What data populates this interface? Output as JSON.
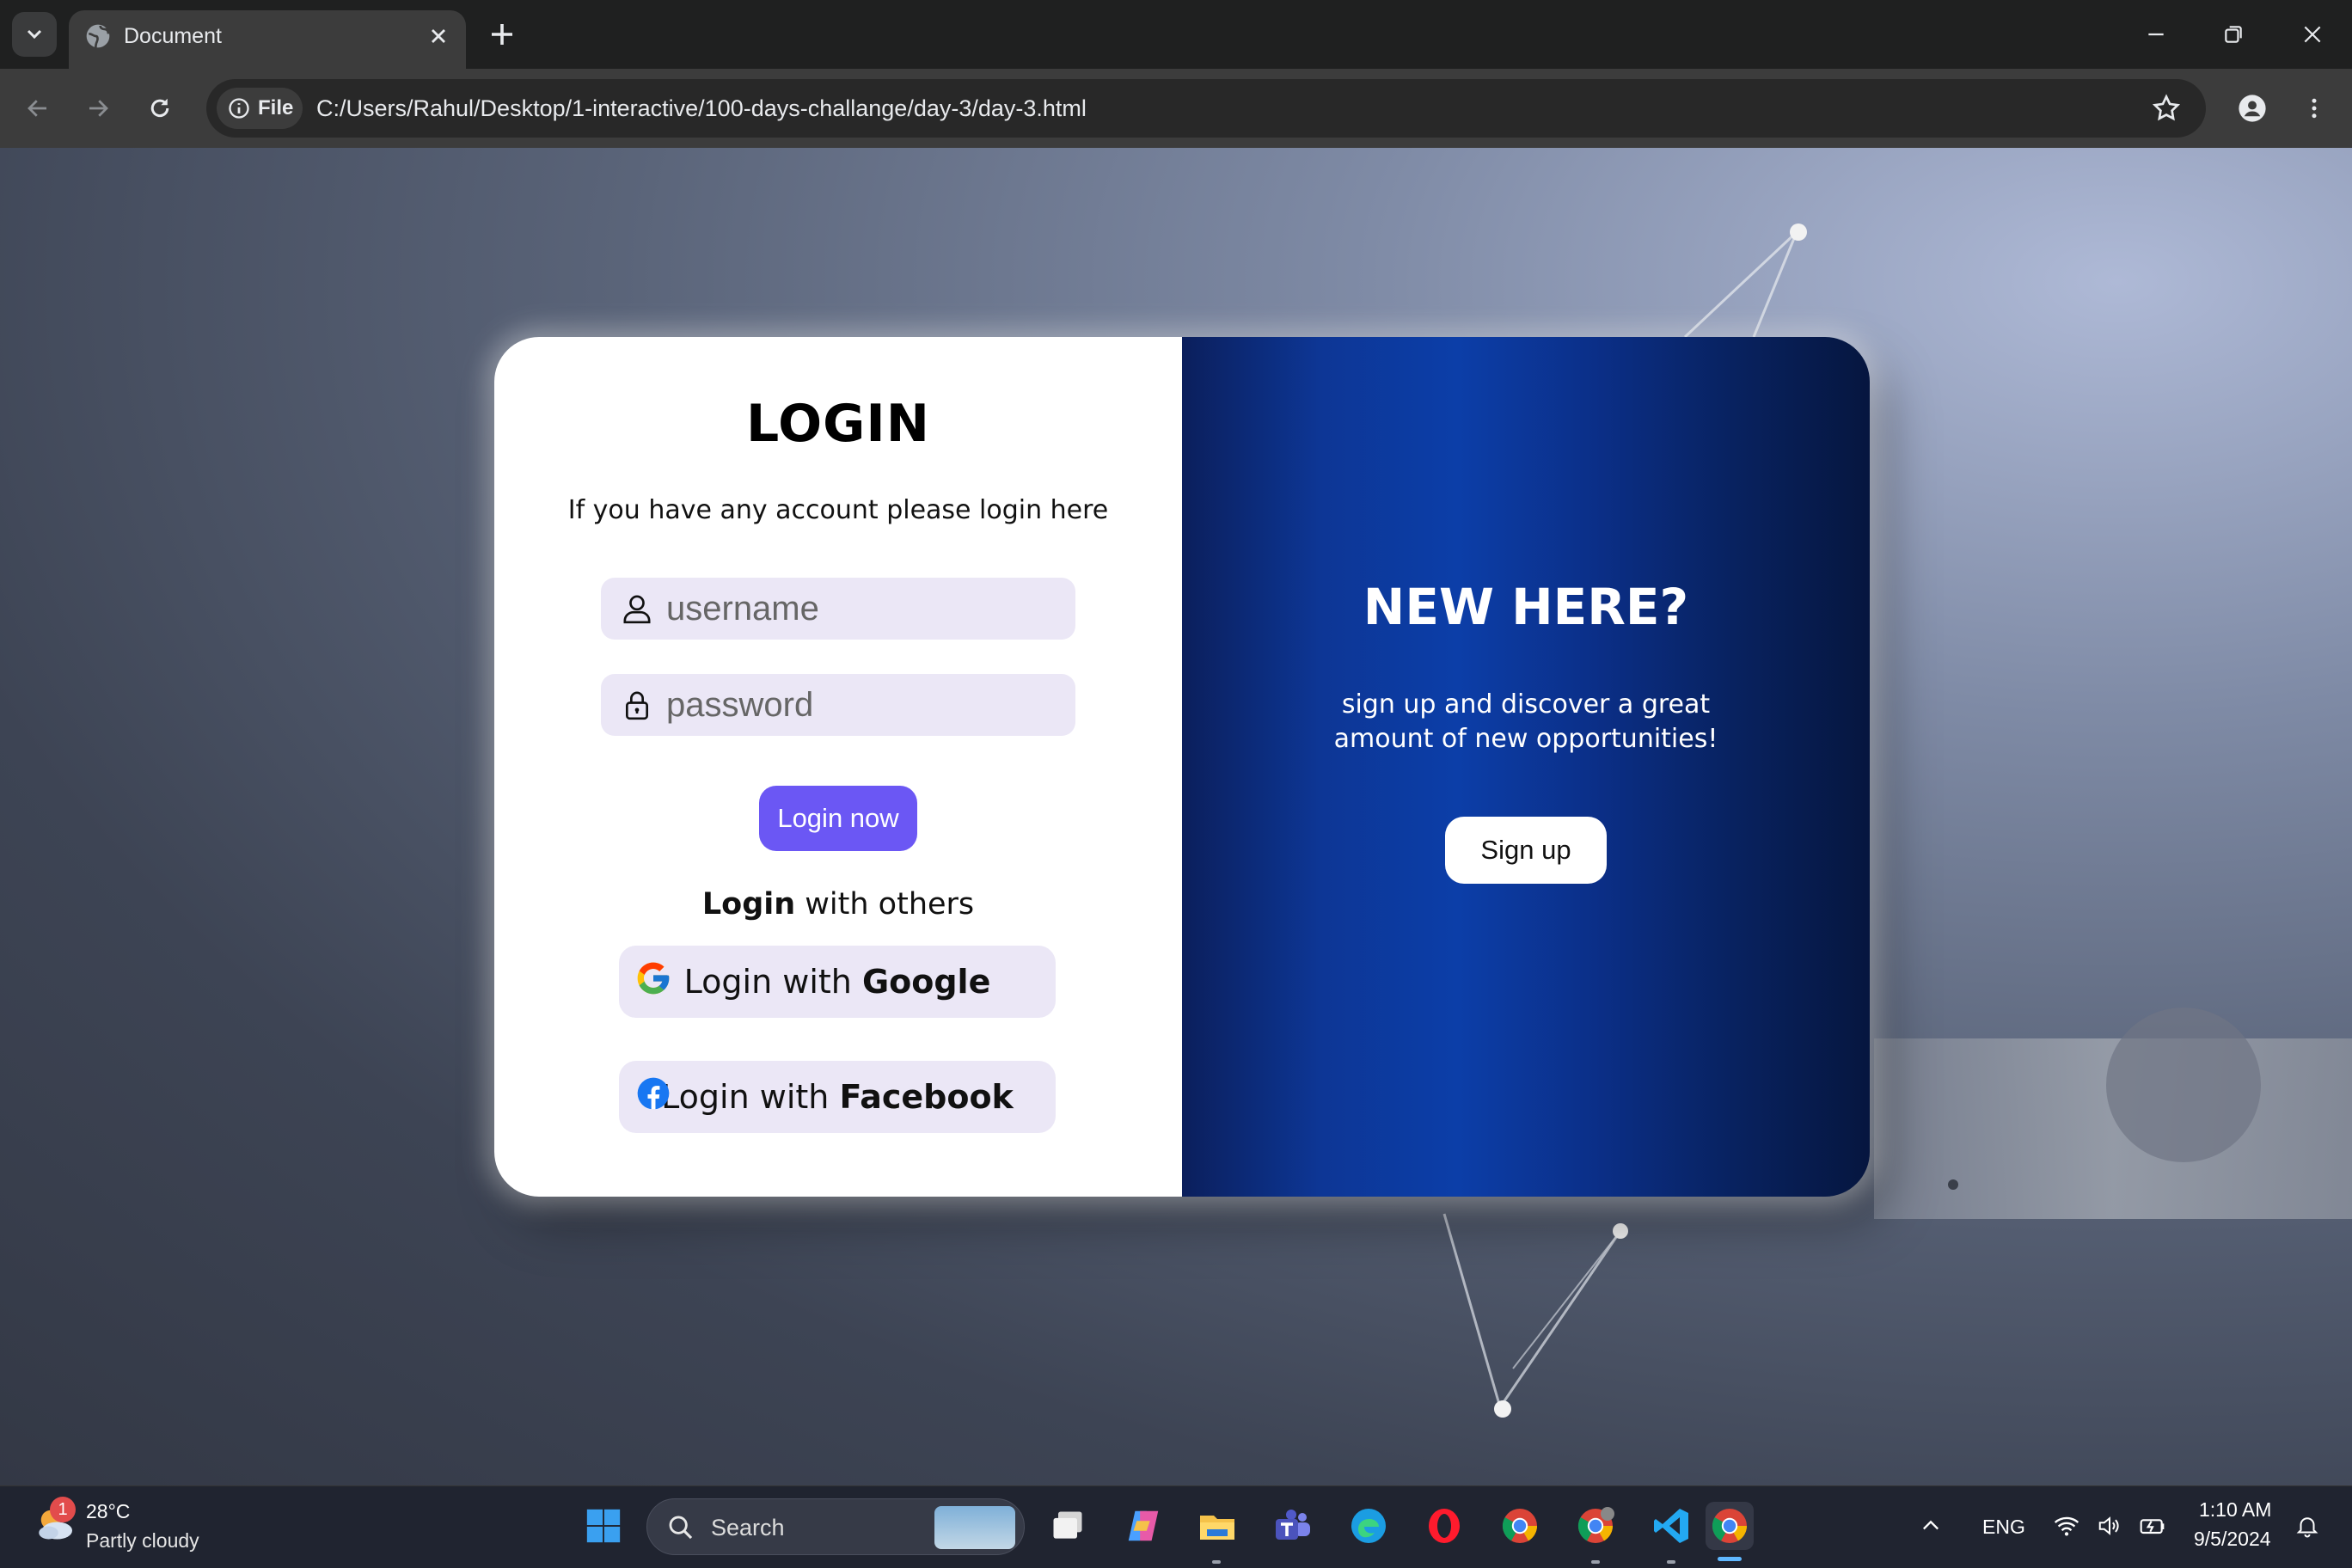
{
  "browser": {
    "tab_title": "Document",
    "address_chip": "File",
    "url": "C:/Users/Rahul/Desktop/1-interactive/100-days-challange/day-3/day-3.html"
  },
  "login": {
    "title": "LOGIN",
    "subtitle": "If you have any account please login here",
    "username_placeholder": "username",
    "password_placeholder": "password",
    "login_button": "Login now",
    "others_bold": "Login",
    "others_rest": " with others",
    "google_prefix": "Login with ",
    "google_brand": "Google",
    "facebook_prefix": "Login with ",
    "facebook_brand": "Facebook"
  },
  "signup": {
    "title": "NEW HERE?",
    "subtitle": "sign up and discover a great amount of new opportunities!",
    "button": "Sign up"
  },
  "taskbar": {
    "weather_badge": "1",
    "temperature": "28°C",
    "condition": "Partly cloudy",
    "search_label": "Search",
    "language": "ENG",
    "time": "1:10 AM",
    "date": "9/5/2024"
  }
}
